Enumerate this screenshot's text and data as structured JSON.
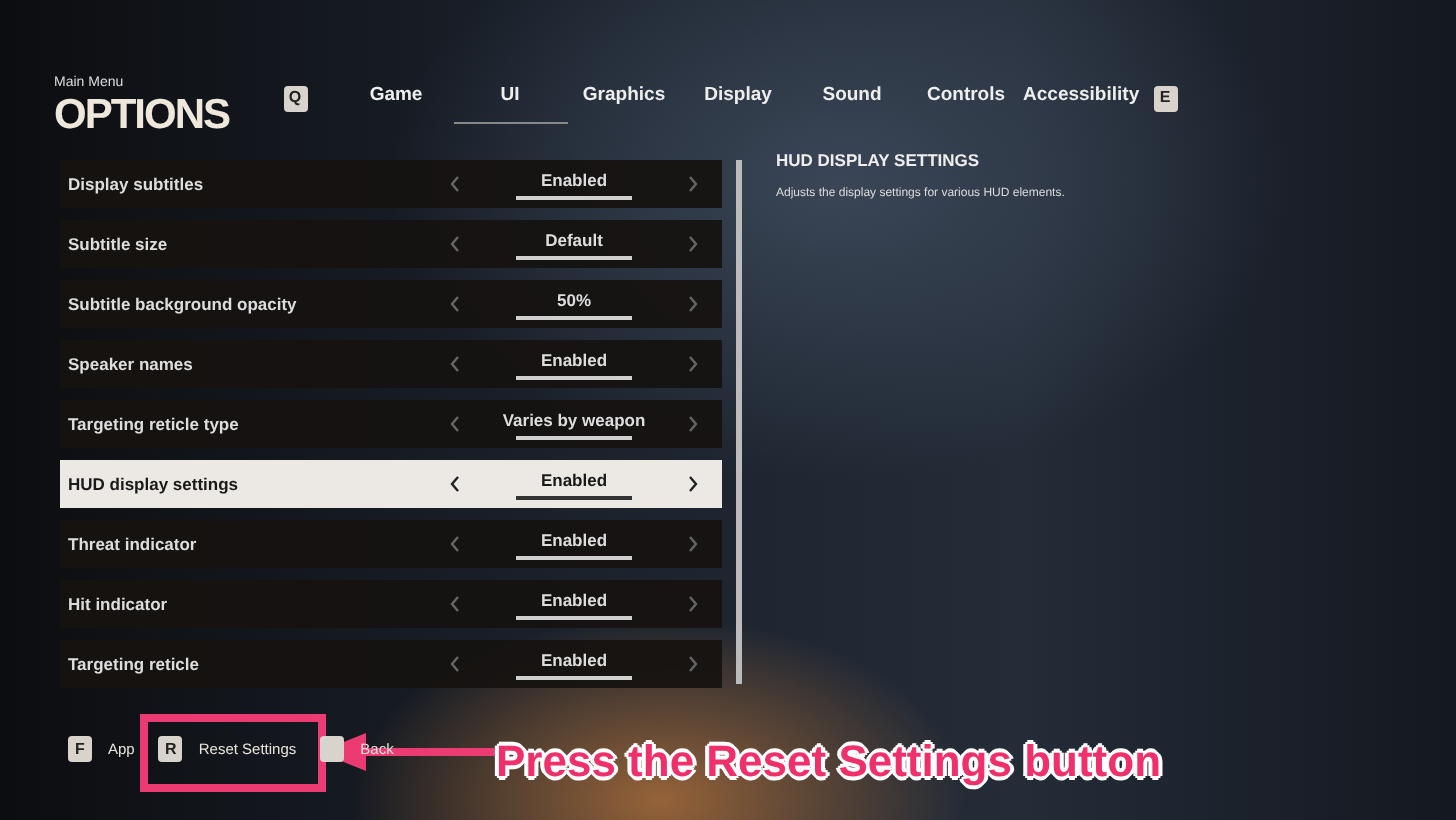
{
  "header": {
    "breadcrumb": "Main Menu",
    "title": "OPTIONS",
    "prev_key": "Q",
    "next_key": "E"
  },
  "tabs": [
    {
      "label": "Game",
      "selected": false
    },
    {
      "label": "UI",
      "selected": true
    },
    {
      "label": "Graphics",
      "selected": false
    },
    {
      "label": "Display",
      "selected": false
    },
    {
      "label": "Sound",
      "selected": false
    },
    {
      "label": "Controls",
      "selected": false
    },
    {
      "label": "Accessibility",
      "selected": false
    }
  ],
  "settings": [
    {
      "label": "Display subtitles",
      "value": "Enabled",
      "selected": false
    },
    {
      "label": "Subtitle size",
      "value": "Default",
      "selected": false
    },
    {
      "label": "Subtitle background opacity",
      "value": "50%",
      "selected": false
    },
    {
      "label": "Speaker names",
      "value": "Enabled",
      "selected": false
    },
    {
      "label": "Targeting reticle type",
      "value": "Varies by weapon",
      "selected": false
    },
    {
      "label": "HUD display settings",
      "value": "Enabled",
      "selected": true
    },
    {
      "label": "Threat indicator",
      "value": "Enabled",
      "selected": false
    },
    {
      "label": "Hit indicator",
      "value": "Enabled",
      "selected": false
    },
    {
      "label": "Targeting reticle",
      "value": "Enabled",
      "selected": false
    }
  ],
  "detail": {
    "heading": "HUD DISPLAY SETTINGS",
    "description": "Adjusts the display settings for various HUD elements."
  },
  "footer": [
    {
      "key": "F",
      "label": "App"
    },
    {
      "key": "R",
      "label": "Reset Settings"
    },
    {
      "label": "Back"
    }
  ],
  "annotation": {
    "caption": "Press the Reset Settings button"
  }
}
